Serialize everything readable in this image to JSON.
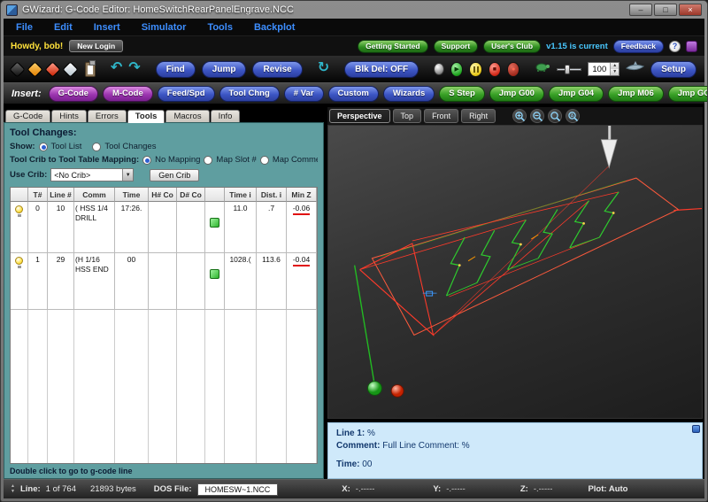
{
  "window": {
    "title": "GWizard: G-Code Editor: HomeSwitchRearPanelEngrave.NCC"
  },
  "menubar": {
    "items": [
      "File",
      "Edit",
      "Insert",
      "Simulator",
      "Tools",
      "Backplot"
    ]
  },
  "account_bar": {
    "greeting": "Howdy, bob!",
    "new_login": "New Login",
    "getting_started": "Getting Started",
    "support": "Support",
    "users_club": "User's Club",
    "version_status": "v1.15 is current",
    "feedback": "Feedback"
  },
  "toolbar": {
    "find": "Find",
    "jump": "Jump",
    "revise": "Revise",
    "blk_del": "Blk Del: OFF",
    "speed": "100",
    "setup": "Setup"
  },
  "insert_bar": {
    "label": "Insert:",
    "items": [
      {
        "label": "G-Code"
      },
      {
        "label": "M-Code"
      },
      {
        "label": "Feed/Spd"
      },
      {
        "label": "Tool Chng"
      },
      {
        "label": "# Var"
      },
      {
        "label": "Custom"
      },
      {
        "label": "Wizards"
      },
      {
        "label": "S Step"
      },
      {
        "label": "Jmp G00"
      },
      {
        "label": "Jmp G04"
      },
      {
        "label": "Jmp M06"
      },
      {
        "label": "Jmp GOTO"
      }
    ]
  },
  "left_panel": {
    "tabs": [
      "G-Code",
      "Hints",
      "Errors",
      "Tools",
      "Macros",
      "Info"
    ],
    "heading": "Tool Changes:",
    "show_label": "Show:",
    "show_option1": "Tool List",
    "show_option2": "Tool Changes",
    "mapping_label": "Tool Crib to Tool Table Mapping:",
    "mapping_option1": "No Mapping",
    "mapping_option2": "Map Slot #",
    "mapping_option3": "Map Comme",
    "use_crib_label": "Use Crib:",
    "crib_value": "<No Crib>",
    "gen_crib_label": "Gen Crib",
    "table": {
      "headers": [
        "",
        "T#",
        "Line #",
        "Comm",
        "Time",
        "H# Co",
        "D# Co",
        "",
        "Time i",
        "Dist. i",
        "Min Z"
      ],
      "rows": [
        {
          "t_num": "0",
          "line": "10",
          "comment": "( HSS 1/4 DRILL",
          "time": "17:26.",
          "h_code": "",
          "d_code": "",
          "time_in": "11.0",
          "dist": ".7",
          "min_z": "-0.06"
        },
        {
          "t_num": "1",
          "line": "29",
          "comment": "(H 1/16 HSS END",
          "time": "00",
          "h_code": "",
          "d_code": "",
          "time_in": "1028.(",
          "dist": "113.6",
          "min_z": "-0.04"
        }
      ]
    },
    "footer_hint": "Double click to go to g-code line"
  },
  "viewport": {
    "tabs": [
      "Perspective",
      "Top",
      "Front",
      "Right"
    ],
    "info": {
      "line_label": "Line 1:",
      "line_value": "%",
      "comment_label": "Comment:",
      "comment_value": "Full Line Comment: %",
      "time_label": "Time:",
      "time_value": "00"
    }
  },
  "status_bar": {
    "line_label": "Line:",
    "line_value": "1 of 764",
    "bytes": "21893 bytes",
    "dos_label": "DOS File:",
    "dos_value": "HOMESW~1.NCC",
    "x_label": "X:",
    "x_value": "-.-----",
    "y_label": "Y:",
    "y_value": "-.-----",
    "z_label": "Z:",
    "z_value": "-.-----",
    "plot": "Plot: Auto"
  },
  "icons": {
    "undo": "↶",
    "redo": "↷",
    "refresh": "↻",
    "play": "▶",
    "stop": "■",
    "rewind": "●",
    "spin_up": "▲",
    "spin_down": "▼",
    "dropdown": "▼",
    "help": "?",
    "min": "–",
    "max": "□",
    "close": "×"
  },
  "colors": {
    "panel_teal": "#5f9ea0",
    "accent_green": "#2f8f20",
    "accent_blue": "#3c55c4",
    "accent_purple": "#9c35b0",
    "path_green": "#2ecc2e",
    "path_red": "#ff4a3a",
    "info_bg": "#cfe9fa"
  }
}
